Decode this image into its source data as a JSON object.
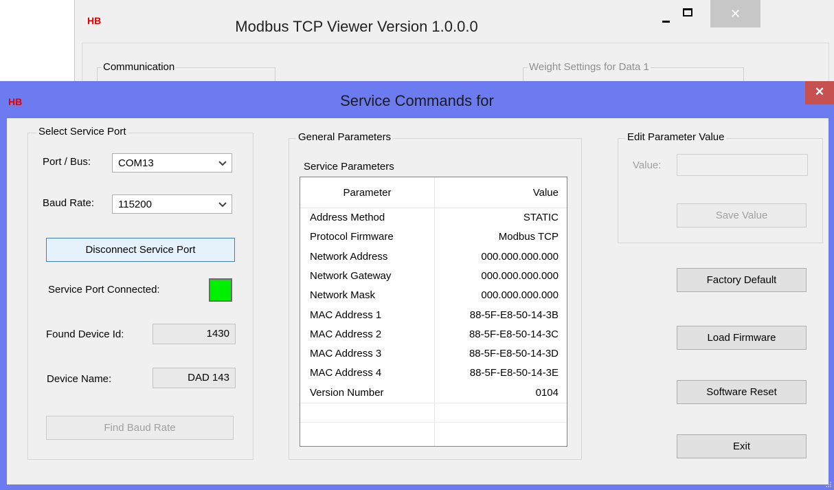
{
  "background_window": {
    "logo": "HB",
    "title": "Modbus TCP Viewer Version 1.0.0.0",
    "close_glyph": "✕",
    "group_communication": "Communication",
    "group_weight": "Weight Settings for Data 1"
  },
  "dialog": {
    "logo": "HB",
    "title": "Service Commands for",
    "close_glyph": "✕",
    "title_bar_color": "#6c7cf0",
    "close_color": "#c75050"
  },
  "service_port": {
    "group_label": "Select Service Port",
    "port_label": "Port / Bus:",
    "port_value": "COM13",
    "baud_label": "Baud Rate:",
    "baud_value": "115200",
    "disconnect_button": "Disconnect Service Port",
    "connected_label": "Service Port Connected:",
    "connected_color": "#00f000",
    "device_id_label": "Found Device Id:",
    "device_id_value": "1430",
    "device_name_label": "Device Name:",
    "device_name_value": "DAD 143",
    "find_baud_button": "Find Baud Rate"
  },
  "general": {
    "group_label": "General Parameters",
    "sub_label": "Service Parameters",
    "col_parameter": "Parameter",
    "col_value": "Value",
    "rows": [
      {
        "p": "Address Method",
        "v": "STATIC"
      },
      {
        "p": "Protocol Firmware",
        "v": "Modbus TCP"
      },
      {
        "p": "Network Address",
        "v": "000.000.000.000"
      },
      {
        "p": "Network Gateway",
        "v": "000.000.000.000"
      },
      {
        "p": "Network Mask",
        "v": "000.000.000.000"
      },
      {
        "p": "MAC Address 1",
        "v": "88-5F-E8-50-14-3B"
      },
      {
        "p": "MAC Address 2",
        "v": "88-5F-E8-50-14-3C"
      },
      {
        "p": "MAC Address 3",
        "v": "88-5F-E8-50-14-3D"
      },
      {
        "p": "MAC Address 4",
        "v": "88-5F-E8-50-14-3E"
      },
      {
        "p": "Version Number",
        "v": "0104"
      }
    ]
  },
  "edit": {
    "group_label": "Edit Parameter Value",
    "value_label": "Value:",
    "value_text": "",
    "save_button": "Save Value"
  },
  "actions": {
    "factory_default": "Factory Default",
    "load_firmware": "Load Firmware",
    "software_reset": "Software Reset",
    "exit": "Exit"
  }
}
